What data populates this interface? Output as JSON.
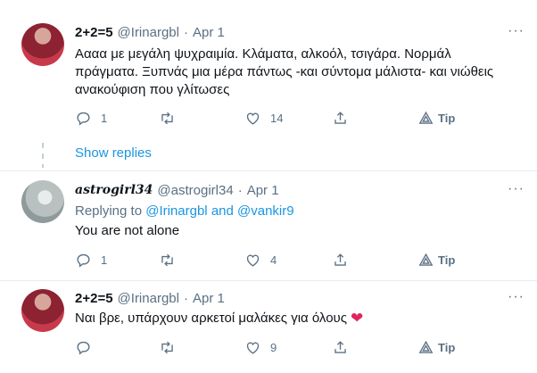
{
  "tweets": [
    {
      "name": "2+2=5",
      "handle": "@Irinargbl",
      "dot": "·",
      "date": "Apr 1",
      "text": "Αααα με μεγάλη ψυχραιμία. Κλάματα, αλκοόλ, τσιγάρα. Νορμάλ πράγματα. Ξυπνάς μια μέρα πάντως -και σύντομα μάλιστα- και νιώθεις ανακούφιση που γλίτωσες",
      "replies": "1",
      "retweets": "",
      "likes": "14",
      "tip": "Tip",
      "more": "···"
    },
    {
      "name": "astrogirl34",
      "handle": "@astrogirl34",
      "dot": "·",
      "date": "Apr 1",
      "replying_prefix": "Replying to",
      "replying_user1": "@Irinargbl",
      "replying_and": "and",
      "replying_user2": "@vankir9",
      "text": "You are not alone",
      "replies": "1",
      "retweets": "",
      "likes": "4",
      "tip": "Tip",
      "more": "···"
    },
    {
      "name": "2+2=5",
      "handle": "@Irinargbl",
      "dot": "·",
      "date": "Apr 1",
      "text": "Ναι βρε, υπάρχουν αρκετοί μαλάκες για όλους",
      "heart": "❤",
      "replies": "",
      "retweets": "",
      "likes": "9",
      "tip": "Tip",
      "more": "···"
    }
  ],
  "show_replies": "Show replies",
  "colors": {
    "link": "#1b95e0",
    "muted": "#5b7083",
    "heart": "#e0245e"
  },
  "icons": [
    "reply-icon",
    "retweet-icon",
    "like-icon",
    "share-icon",
    "tip-icon",
    "more-icon"
  ]
}
